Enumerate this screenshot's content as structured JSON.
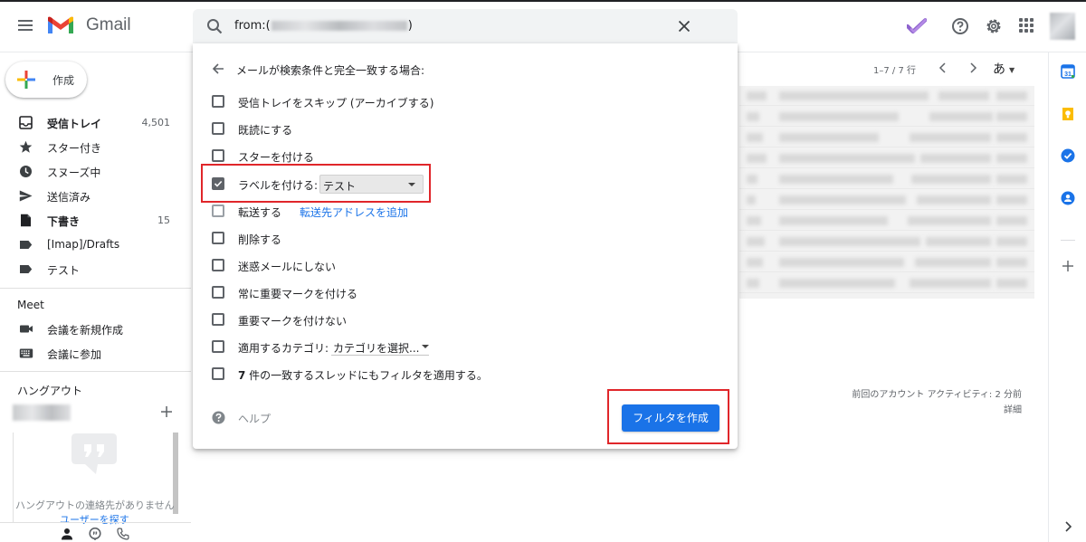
{
  "app": {
    "name": "Gmail"
  },
  "search": {
    "query_prefix": "from:(",
    "query_suffix": ")"
  },
  "compose": {
    "label": "作成"
  },
  "sidebar": {
    "items": [
      {
        "label": "受信トレイ",
        "count": "4,501",
        "icon": "inbox-icon",
        "bold": true
      },
      {
        "label": "スター付き",
        "count": "",
        "icon": "star-icon",
        "bold": false
      },
      {
        "label": "スヌーズ中",
        "count": "",
        "icon": "clock-icon",
        "bold": false
      },
      {
        "label": "送信済み",
        "count": "",
        "icon": "send-icon",
        "bold": false
      },
      {
        "label": "下書き",
        "count": "15",
        "icon": "draft-icon",
        "bold": true
      },
      {
        "label": "[Imap]/Drafts",
        "count": "",
        "icon": "label-icon",
        "bold": false
      },
      {
        "label": "テスト",
        "count": "",
        "icon": "label-icon",
        "bold": false
      }
    ]
  },
  "meet": {
    "title": "Meet",
    "items": [
      {
        "label": "会議を新規作成",
        "icon": "video-icon"
      },
      {
        "label": "会議に参加",
        "icon": "keyboard-icon"
      }
    ]
  },
  "hangouts": {
    "title": "ハングアウト",
    "empty_text": "ハングアウトの連絡先がありません",
    "find_link": "ユーザーを探す"
  },
  "pager": {
    "range": "1–7 / 7 行",
    "input_tool": "あ"
  },
  "activity": {
    "line1": "前回のアカウント アクティビティ: 2 分前",
    "line2": "詳細"
  },
  "filter": {
    "title": "メールが検索条件と完全一致する場合:",
    "options": [
      {
        "label": "受信トレイをスキップ (アーカイブする)",
        "checked": false
      },
      {
        "label": "既読にする",
        "checked": false
      },
      {
        "label": "スターを付ける",
        "checked": false
      },
      {
        "label": "ラベルを付ける:",
        "checked": true,
        "select_value": "テスト"
      },
      {
        "label": "転送する",
        "checked": false,
        "link": "転送先アドレスを追加"
      },
      {
        "label": "削除する",
        "checked": false
      },
      {
        "label": "迷惑メールにしない",
        "checked": false
      },
      {
        "label": "常に重要マークを付ける",
        "checked": false
      },
      {
        "label": "重要マークを付けない",
        "checked": false
      },
      {
        "label": "適用するカテゴリ:",
        "checked": false,
        "select_value": "カテゴリを選択..."
      },
      {
        "label": "7 件の一致するスレッドにもフィルタを適用する。",
        "checked": false,
        "bold_prefix": "7"
      }
    ],
    "help": "ヘルプ",
    "create_button": "フィルタを作成"
  },
  "colors": {
    "accent": "#1a73e8",
    "highlight": "#e0262a",
    "rail_calendar": "#1a73e8",
    "rail_keep": "#fbbc04"
  }
}
